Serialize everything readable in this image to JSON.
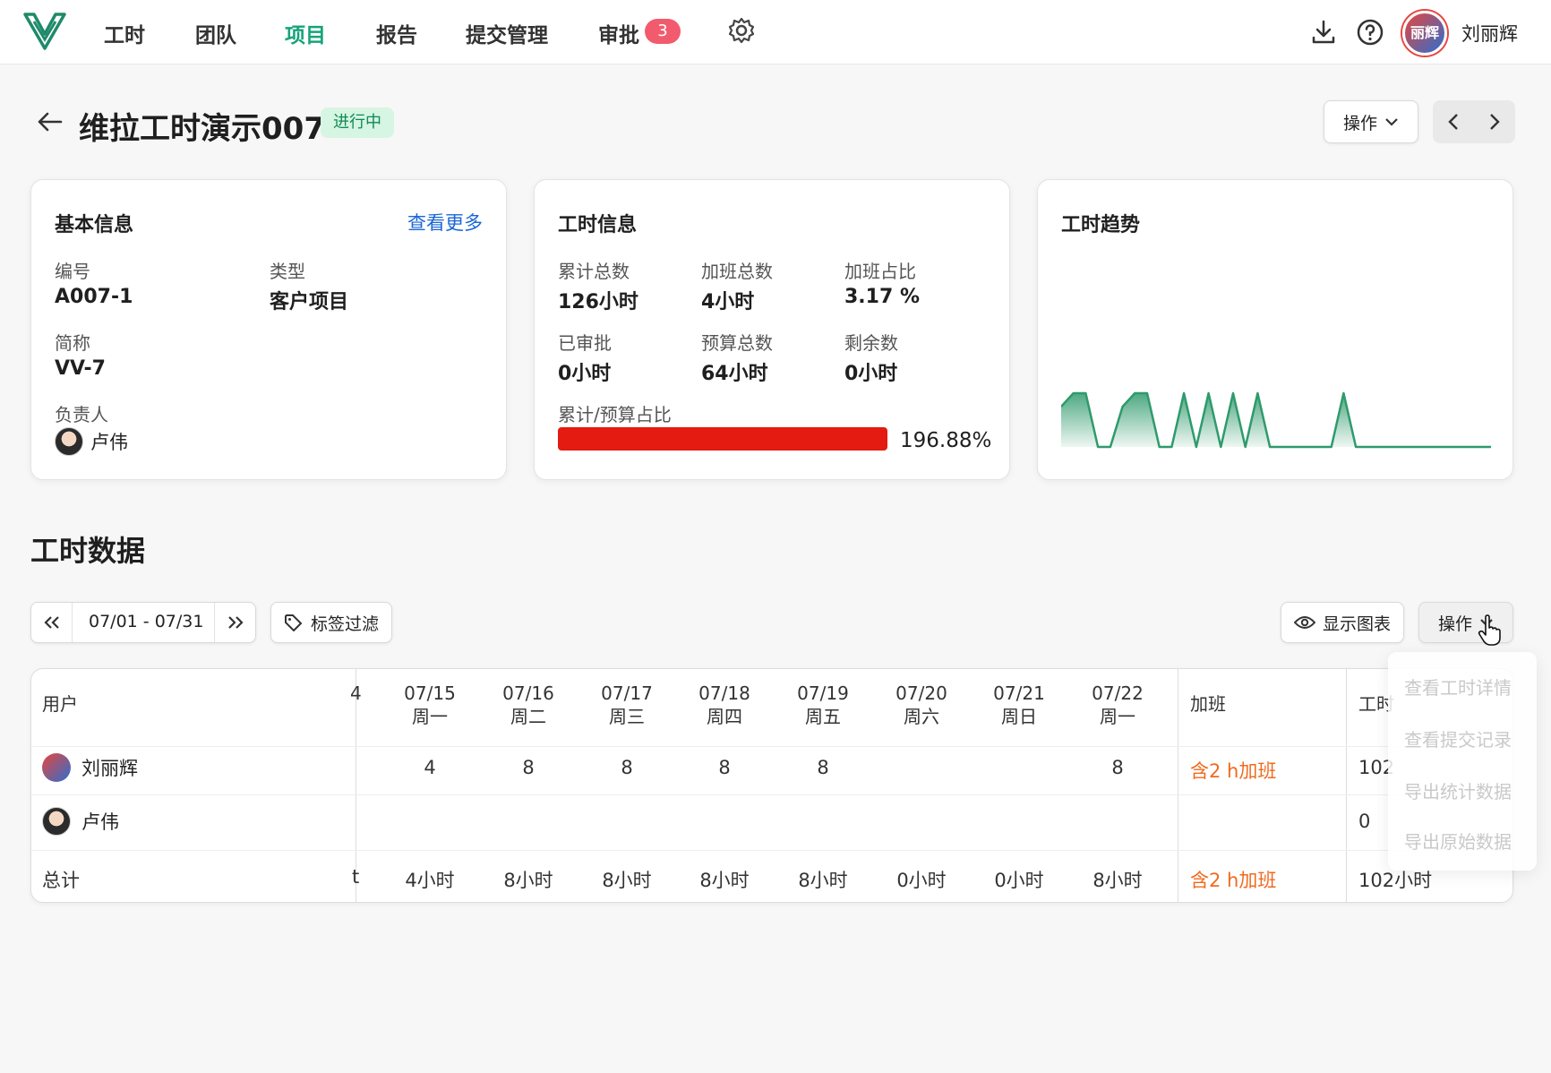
{
  "nav": {
    "items": [
      {
        "label": "工时",
        "active": false
      },
      {
        "label": "团队",
        "active": false
      },
      {
        "label": "项目",
        "active": true
      },
      {
        "label": "报告",
        "active": false
      },
      {
        "label": "提交管理",
        "active": false
      },
      {
        "label": "审批",
        "active": false
      }
    ],
    "approval_badge": "3",
    "icons": [
      "logo-icon",
      "gear-icon",
      "download-icon",
      "help-icon"
    ],
    "user": {
      "name": "刘丽辉",
      "avatar_text": "丽辉"
    }
  },
  "header": {
    "title": "维拉工时演示007",
    "status": "进行中",
    "action_label": "操作"
  },
  "basic_info": {
    "title": "基本信息",
    "more_link": "查看更多",
    "code_label": "编号",
    "code_value": "A007-1",
    "type_label": "类型",
    "type_value": "客户项目",
    "short_label": "简称",
    "short_value": "VV-7",
    "owner_label": "负责人",
    "owner_value": "卢伟"
  },
  "hours_info": {
    "title": "工时信息",
    "total_label": "累计总数",
    "total_value": "126小时",
    "overtime_label": "加班总数",
    "overtime_value": "4小时",
    "overtime_ratio_label": "加班占比",
    "overtime_ratio_value": "3.17 %",
    "approved_label": "已审批",
    "approved_value": "0小时",
    "budget_label": "预算总数",
    "budget_value": "64小时",
    "remaining_label": "剩余数",
    "remaining_value": "0小时",
    "ratio_label": "累计/预算占比",
    "ratio_value": "196.88%",
    "ratio_fill": 1.0
  },
  "trend": {
    "title": "工时趋势",
    "color": "#2f9a6c",
    "values": [
      6,
      8,
      8,
      0,
      0,
      6,
      8,
      8,
      0,
      0,
      8,
      0,
      8,
      0,
      8,
      0,
      8,
      0,
      0,
      0,
      0,
      0,
      0,
      8,
      0,
      0,
      0,
      0,
      0,
      0,
      0,
      0,
      0,
      0,
      0,
      0
    ]
  },
  "section": {
    "title": "工时数据",
    "date_range": "07/01 - 07/31",
    "tag_filter": "标签过滤",
    "show_chart": "显示图表",
    "action_label": "操作"
  },
  "table": {
    "user_header": "用户",
    "partial_header": "4",
    "days": [
      {
        "date": "07/15",
        "weekday": "周一"
      },
      {
        "date": "07/16",
        "weekday": "周二"
      },
      {
        "date": "07/17",
        "weekday": "周三"
      },
      {
        "date": "07/18",
        "weekday": "周四"
      },
      {
        "date": "07/19",
        "weekday": "周五"
      },
      {
        "date": "07/20",
        "weekday": "周六"
      },
      {
        "date": "07/21",
        "weekday": "周日"
      },
      {
        "date": "07/22",
        "weekday": "周一"
      }
    ],
    "overtime_header": "加班",
    "hours_header": "工时",
    "rows": [
      {
        "name": "刘丽辉",
        "values": [
          "4",
          "8",
          "8",
          "8",
          "8",
          "",
          "",
          "8"
        ],
        "overtime": "含2 h加班",
        "hours": "102"
      },
      {
        "name": "卢伟",
        "values": [
          "",
          "",
          "",
          "",
          "",
          "",
          "",
          ""
        ],
        "overtime": "",
        "hours": "0"
      }
    ],
    "total_label": "总计",
    "total_partial": "t",
    "totals": [
      "4小时",
      "8小时",
      "8小时",
      "8小时",
      "8小时",
      "0小时",
      "0小时",
      "8小时"
    ],
    "total_overtime": "含2 h加班",
    "total_hours": "102小时"
  },
  "dropdown": {
    "items": [
      "查看工时详情",
      "查看提交记录",
      "导出统计数据",
      "导出原始数据"
    ]
  }
}
